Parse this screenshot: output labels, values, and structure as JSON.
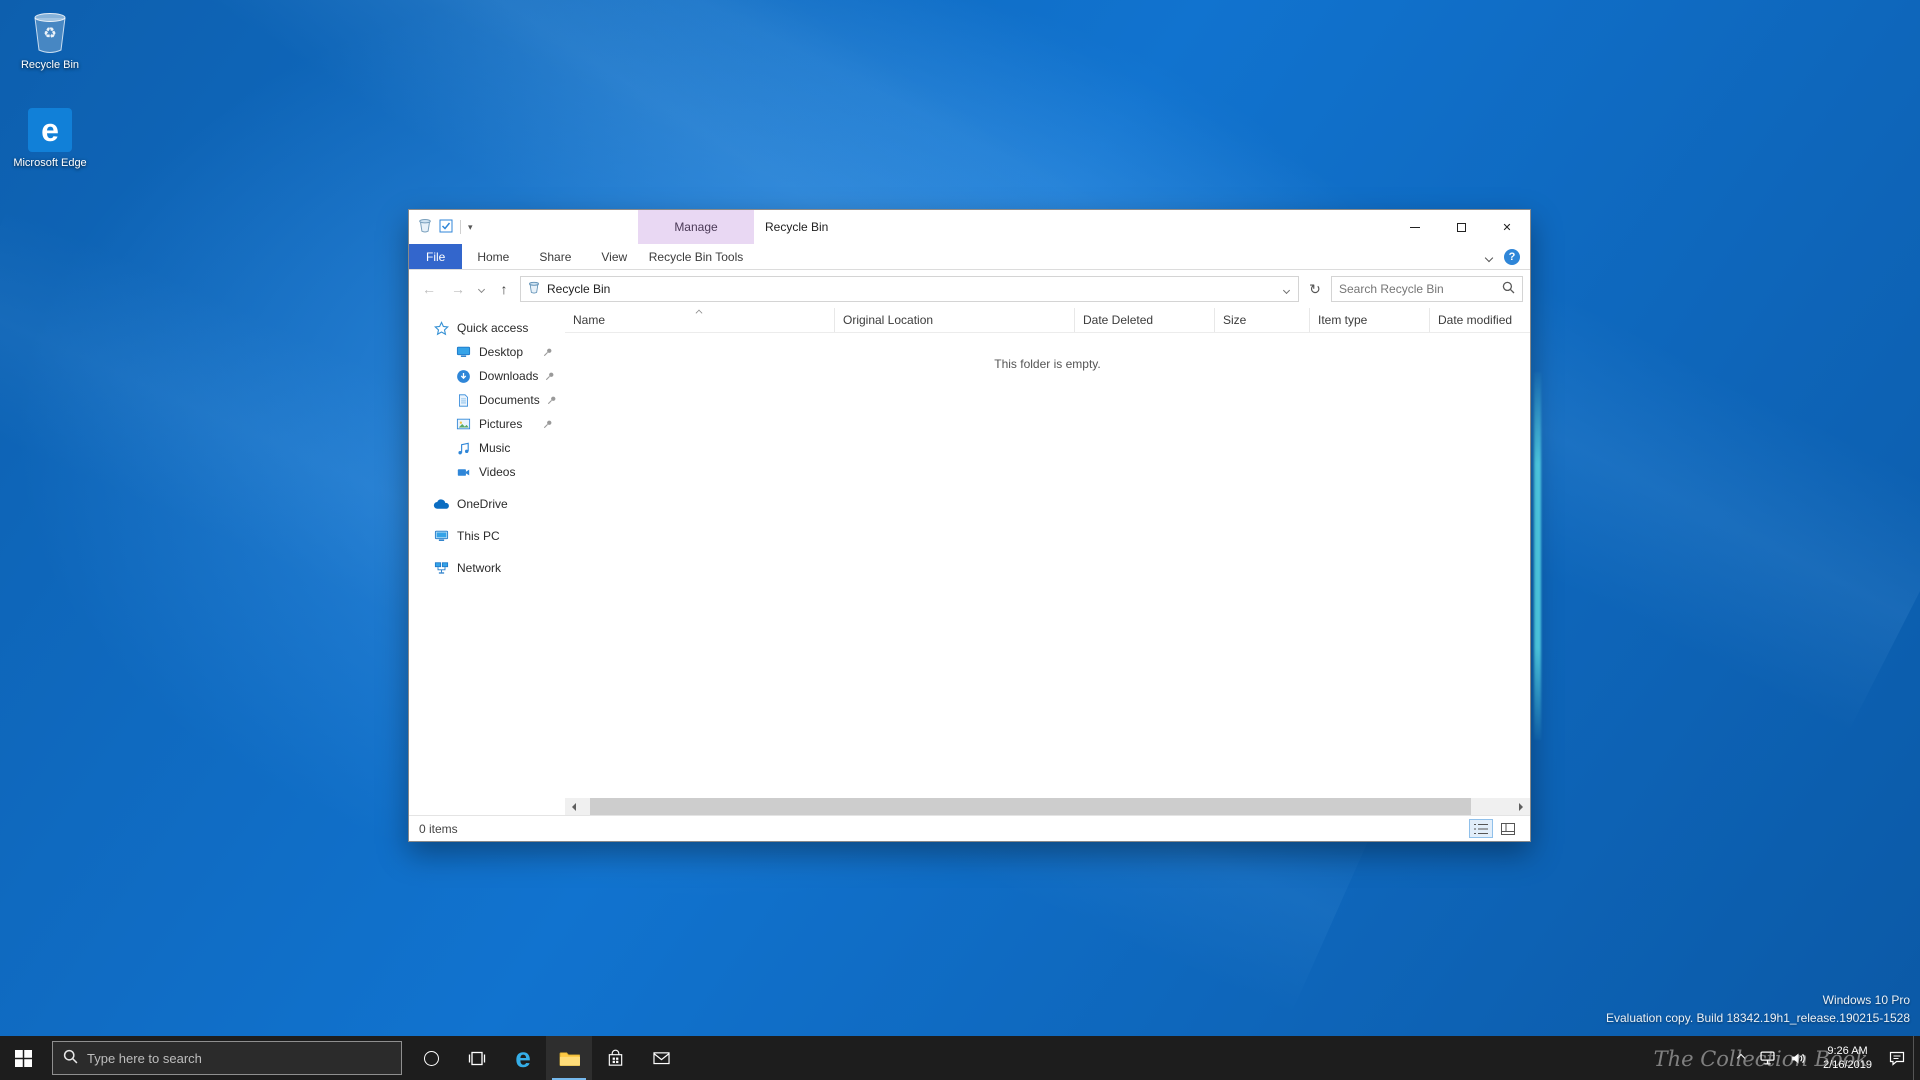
{
  "glyphs": {
    "back": "←",
    "forward": "→",
    "up": "↑",
    "refresh": "↻",
    "close": "✕",
    "qat_more": "▾",
    "help": "?",
    "edge_letter": "e",
    "recycle_symbol": "♻"
  },
  "desktop": {
    "icons": [
      {
        "label": "Recycle Bin"
      },
      {
        "label": "Microsoft Edge"
      }
    ],
    "watermark": {
      "line1": "Windows 10 Pro",
      "line2": "Evaluation copy. Build 18342.19h1_release.190215-1528"
    },
    "recording_watermark": "The Collection Book"
  },
  "window": {
    "title": "Recycle Bin",
    "context_group": "Manage",
    "tabs": {
      "file": "File",
      "home": "Home",
      "share": "Share",
      "view": "View",
      "context": "Recycle Bin Tools"
    },
    "address": "Recycle Bin",
    "search_placeholder": "Search Recycle Bin",
    "sidebar": {
      "quick_access": "Quick access",
      "pinned": [
        "Desktop",
        "Downloads",
        "Documents",
        "Pictures"
      ],
      "unpinned": [
        "Music",
        "Videos"
      ],
      "roots": [
        "OneDrive",
        "This PC",
        "Network"
      ]
    },
    "columns": [
      "Name",
      "Original Location",
      "Date Deleted",
      "Size",
      "Item type",
      "Date modified"
    ],
    "empty_message": "This folder is empty.",
    "status": "0 items"
  },
  "taskbar": {
    "search_placeholder": "Type here to search",
    "time": "9:26 AM",
    "date": "2/16/2019"
  }
}
